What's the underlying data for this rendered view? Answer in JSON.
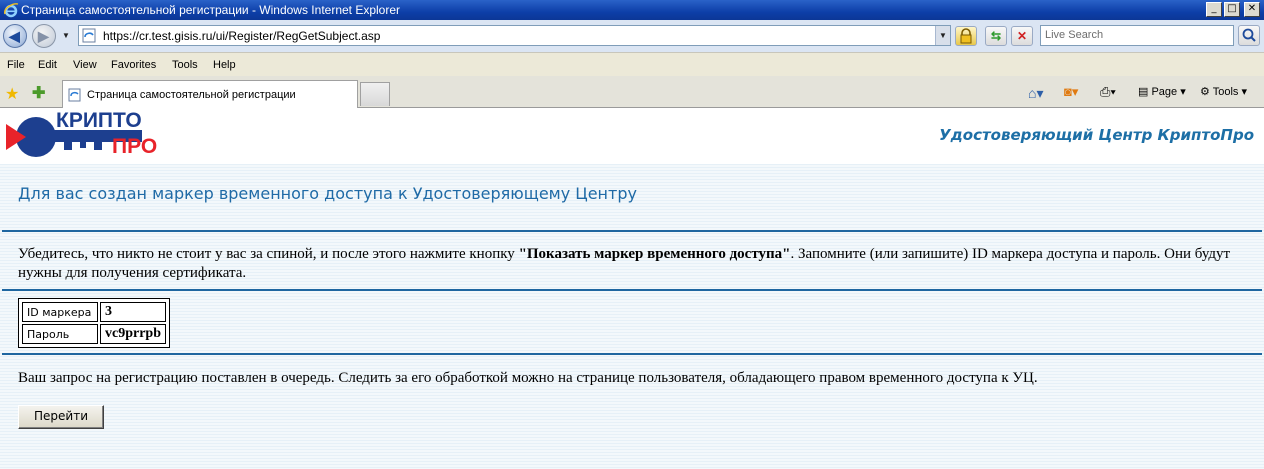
{
  "window": {
    "title": "Страница самостоятельной регистрации - Windows Internet Explorer",
    "min_glyph": "_",
    "max_glyph": "□",
    "close_glyph": "✕"
  },
  "address_bar": {
    "url": "https://cr.test.gisis.ru/ui/Register/RegGetSubject.asp",
    "search_placeholder": "Live Search"
  },
  "menu": {
    "file": "File",
    "edit": "Edit",
    "view": "View",
    "favorites": "Favorites",
    "tools": "Tools",
    "help": "Help"
  },
  "tabs": {
    "active_title": "Страница самостоятельной регистрации"
  },
  "command_bar": {
    "page": "Page",
    "tools": "Tools"
  },
  "page": {
    "logo_line1": "КРИПТО",
    "logo_line2": "ПРО",
    "center_name": "Удостоверяющий Центр КриптоПро",
    "heading": "Для вас создан маркер временного доступа к Удостоверяющему Центру",
    "instruction_before": "Убедитесь, что никто не стоит у вас за спиной, и после этого нажмите кнопку ",
    "instruction_bold": "\"Показать маркер временного доступа\"",
    "instruction_after": ". Запомните (или запишите) ID маркера доступа и пароль. Они будут нужны для получения сертификата.",
    "credentials": {
      "id_label": "ID маркера",
      "id_value": "3",
      "password_label": "Пароль",
      "password_value": "vc9prrpb"
    },
    "queue_text": "Ваш запрос на регистрацию поставлен в очередь. Следить за его обработкой можно на странице пользователя, обладающего правом временного доступа к УЦ.",
    "go_button": "Перейти"
  },
  "colors": {
    "heading": "#1f6aa6",
    "rule": "#1e66a0",
    "logo_blue": "#1d3f8f",
    "logo_red": "#e8232a"
  }
}
